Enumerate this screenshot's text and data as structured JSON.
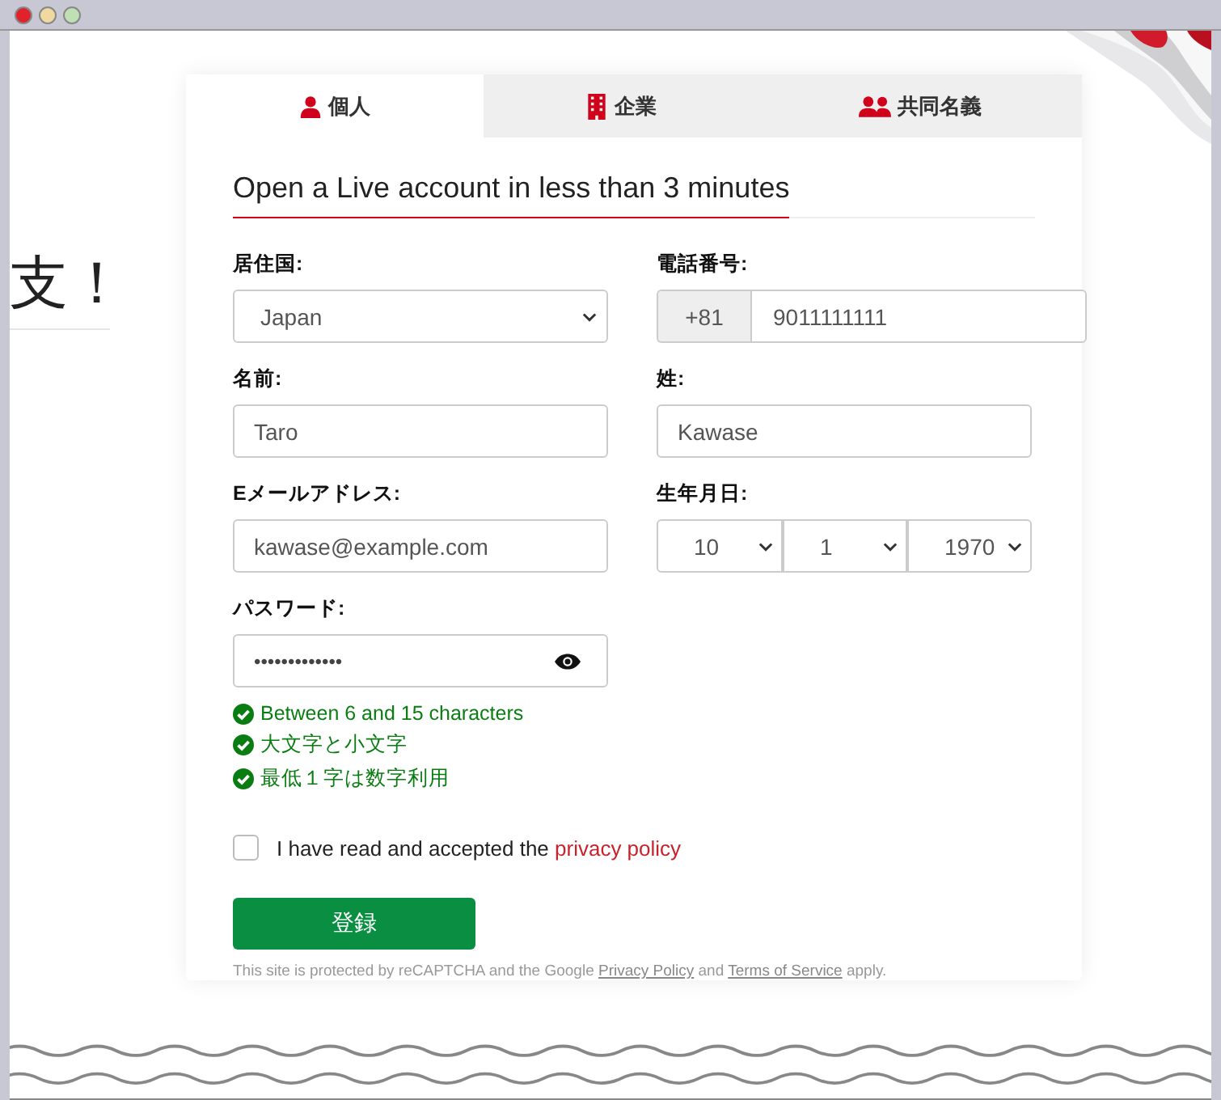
{
  "side_heading": "支！",
  "tabs": [
    {
      "label": "個人",
      "kind": "person",
      "selected": true
    },
    {
      "label": "企業",
      "kind": "building",
      "selected": false
    },
    {
      "label": "共同名義",
      "kind": "group",
      "selected": false
    }
  ],
  "title": "Open a Live account in less than 3 minutes",
  "fields": {
    "country": {
      "label": "居住国:",
      "value": "Japan"
    },
    "phone": {
      "label": "電話番号:",
      "prefix": "+81",
      "value": "9011111111"
    },
    "first_name": {
      "label": "名前:",
      "value": "Taro"
    },
    "last_name": {
      "label": "姓:",
      "value": "Kawase"
    },
    "email": {
      "label": "Eメールアドレス:",
      "value": "kawase@example.com"
    },
    "birthday": {
      "label": "生年月日:",
      "month": "10",
      "day": "1",
      "year": "1970"
    },
    "password": {
      "label": "パスワード:",
      "value": "•••••••••••••"
    }
  },
  "password_rules": [
    {
      "text": "Between 6 and 15 characters",
      "met": true
    },
    {
      "text": "大文字と小文字",
      "met": true
    },
    {
      "text": "最低１字は数字利用",
      "met": true
    }
  ],
  "consent": {
    "checked": false,
    "text": "I have read and accepted the",
    "link": "privacy policy"
  },
  "submit": "登録",
  "recaptcha": {
    "text1": "This site is protected by reCAPTCHA and the Google",
    "link1": "Privacy Policy",
    "text2": "and",
    "link2": "Terms of Service",
    "text3": "apply."
  }
}
